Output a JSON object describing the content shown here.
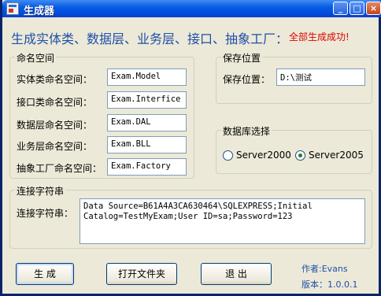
{
  "window": {
    "title": "生成器",
    "controls": {
      "minimize": "_",
      "maximize": "□",
      "close": "×"
    }
  },
  "header": {
    "headline": "生成实体类、数据层、业务层、接口、抽象工厂：",
    "status": "全部生成成功!"
  },
  "namespace_group": {
    "title": "命名空间",
    "rows": [
      {
        "label": "实体类命名空间：",
        "value": "Exam.Model"
      },
      {
        "label": "接口类命名空间：",
        "value": "Exam.Interfice"
      },
      {
        "label": "数据层命名空间：",
        "value": "Exam.DAL"
      },
      {
        "label": "业务层命名空间：",
        "value": "Exam.BLL"
      },
      {
        "label": "抽象工厂命名空间：",
        "value": "Exam.Factory"
      }
    ]
  },
  "save_group": {
    "title": "保存位置",
    "label": "保存位置：",
    "value": "D:\\测试"
  },
  "db_group": {
    "title": "数据库选择",
    "options": [
      "Server2000",
      "Server2005"
    ],
    "selected": "Server2005"
  },
  "conn_group": {
    "title": "连接字符串",
    "label": "连接字符串：",
    "value_line1": "Data Source=B61A4A3CA630464\\SQLEXPRESS;Initial",
    "value_line2": "Catalog=TestMyExam;User ID=sa;Password=123"
  },
  "buttons": {
    "generate": "生 成",
    "open_folder": "打开文件夹",
    "exit": "退 出"
  },
  "footer": {
    "author": "作者:Evans",
    "version": "版本：1.0.0.1"
  }
}
